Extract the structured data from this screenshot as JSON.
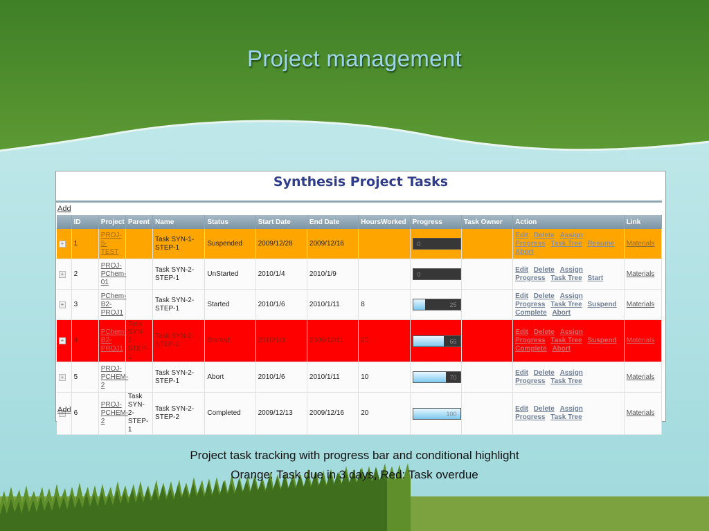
{
  "slide": {
    "title": "Project management",
    "caption_line1": "Project task tracking with progress bar and conditional highlight",
    "caption_line2": "Orange: Task due in 3 days, Red: Task overdue"
  },
  "colors": {
    "header_green": "#4c8a2c",
    "sky": "#a9dde0",
    "orange_highlight": "#ffa500",
    "red_highlight": "#ff0000",
    "heading_blue": "#2f3d8c"
  },
  "panel": {
    "heading": "Synthesis Project Tasks",
    "add_label": "Add"
  },
  "table": {
    "columns": [
      "",
      "ID",
      "Project",
      "Parent",
      "Name",
      "Status",
      "Start Date",
      "End Date",
      "HoursWorked",
      "Progress",
      "Task Owner",
      "Action",
      "Link"
    ],
    "rows": [
      {
        "highlight": "orange",
        "id": "1",
        "project": "PROJ-5-TEST",
        "parent": "",
        "name": "Task SYN-1-STEP-1",
        "status": "Suspended",
        "start": "2009/12/28",
        "end": "2009/12/16",
        "hours": "",
        "progress": 0,
        "progress_label": "0",
        "owner": "",
        "actions": [
          "Edit",
          "Delete",
          "Assign",
          "Progress",
          "Task Tree",
          "Resume",
          "Abort"
        ],
        "link": "Materials"
      },
      {
        "highlight": "none",
        "id": "2",
        "project": "PROJ-PChem-01",
        "parent": "",
        "name": "Task SYN-2-STEP-1",
        "status": "UnStarted",
        "start": "2010/1/4",
        "end": "2010/1/9",
        "hours": "",
        "progress": 0,
        "progress_label": "0",
        "owner": "",
        "actions": [
          "Edit",
          "Delete",
          "Assign",
          "Progress",
          "Task Tree",
          "Start"
        ],
        "link": "Materials"
      },
      {
        "highlight": "none",
        "id": "3",
        "project": "PChem-B2-PROJ1",
        "parent": "",
        "name": "Task SYN-2-STEP-1",
        "status": "Started",
        "start": "2010/1/6",
        "end": "2010/1/11",
        "hours": "8",
        "progress": 25,
        "progress_label": "25",
        "owner": "",
        "actions": [
          "Edit",
          "Delete",
          "Assign",
          "Progress",
          "Task Tree",
          "Suspend",
          "Complete",
          "Abort"
        ],
        "link": "Materials"
      },
      {
        "highlight": "red",
        "id": "4",
        "project": "PChem-B2-PROJ1",
        "parent": "Task SYN-2-STEP-1",
        "name": "Task SYN-2-STEP-2",
        "status": "Started",
        "start": "2010/1/3",
        "end": "2006/12/11",
        "hours": "20",
        "progress": 65,
        "progress_label": "65",
        "owner": "",
        "actions": [
          "Edit",
          "Delete",
          "Assign",
          "Progress",
          "Task Tree",
          "Suspend",
          "Complete",
          "Abort"
        ],
        "link": "Materials"
      },
      {
        "highlight": "none",
        "id": "5",
        "project": "PROJ-PCHEM-2",
        "parent": "",
        "name": "Task SYN-2-STEP-1",
        "status": "Abort",
        "start": "2010/1/6",
        "end": "2010/1/11",
        "hours": "10",
        "progress": 70,
        "progress_label": "70",
        "owner": "",
        "actions": [
          "Edit",
          "Delete",
          "Assign",
          "Progress",
          "Task Tree"
        ],
        "link": "Materials"
      },
      {
        "highlight": "none",
        "id": "6",
        "project": "PROJ-PCHEM-2",
        "parent": "Task SYN-2-STEP-1",
        "name": "Task SYN-2-STEP-2",
        "status": "Completed",
        "start": "2009/12/13",
        "end": "2009/12/16",
        "hours": "20",
        "progress": 100,
        "progress_label": "100",
        "owner": "",
        "actions": [
          "Edit",
          "Delete",
          "Assign",
          "Progress",
          "Task Tree"
        ],
        "link": "Materials"
      }
    ]
  }
}
